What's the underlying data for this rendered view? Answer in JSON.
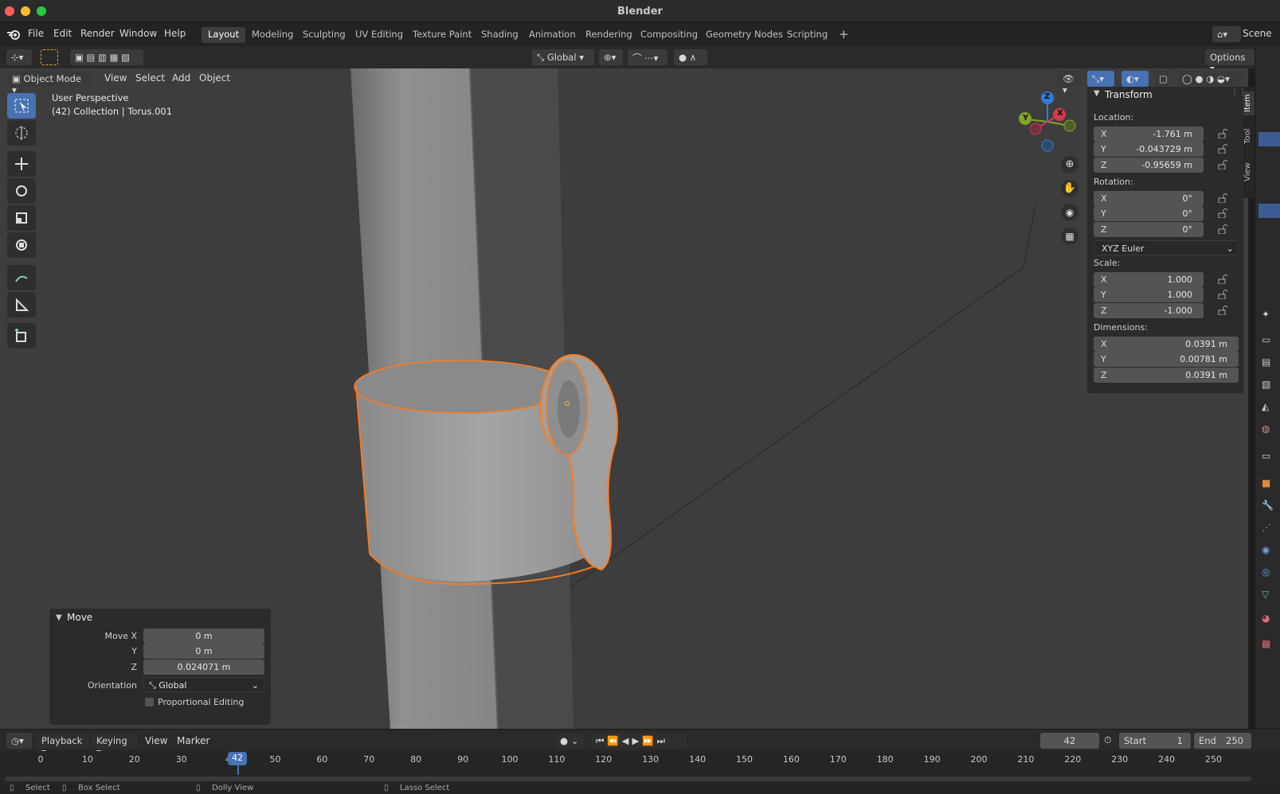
{
  "window": {
    "title": "Blender"
  },
  "menu": {
    "items": [
      "File",
      "Edit",
      "Render",
      "Window",
      "Help"
    ]
  },
  "workspaces": [
    "Layout",
    "Modeling",
    "Sculpting",
    "UV Editing",
    "Texture Paint",
    "Shading",
    "Animation",
    "Rendering",
    "Compositing",
    "Geometry Nodes",
    "Scripting"
  ],
  "active_workspace": "Layout",
  "scene_label": "Scene",
  "header": {
    "orientation": "Global",
    "options": "Options"
  },
  "viewport_header": {
    "mode": "Object Mode",
    "menus": [
      "View",
      "Select",
      "Add",
      "Object"
    ]
  },
  "overlay": {
    "perspective": "User Perspective",
    "collection": "(42) Collection | Torus.001"
  },
  "gizmo": {
    "x": "X",
    "y": "Y",
    "z": "Z"
  },
  "npanel": {
    "section": "Transform",
    "location_label": "Location:",
    "location": [
      {
        "axis": "X",
        "value": "-1.761 m"
      },
      {
        "axis": "Y",
        "value": "-0.043729 m"
      },
      {
        "axis": "Z",
        "value": "-0.95659 m"
      }
    ],
    "rotation_label": "Rotation:",
    "rotation": [
      {
        "axis": "X",
        "value": "0°"
      },
      {
        "axis": "Y",
        "value": "0°"
      },
      {
        "axis": "Z",
        "value": "0°"
      }
    ],
    "rotation_mode": "XYZ Euler",
    "scale_label": "Scale:",
    "scale": [
      {
        "axis": "X",
        "value": "1.000"
      },
      {
        "axis": "Y",
        "value": "1.000"
      },
      {
        "axis": "Z",
        "value": "-1.000"
      }
    ],
    "dimensions_label": "Dimensions:",
    "dimensions": [
      {
        "axis": "X",
        "value": "0.0391 m"
      },
      {
        "axis": "Y",
        "value": "0.00781 m"
      },
      {
        "axis": "Z",
        "value": "0.0391 m"
      }
    ],
    "tabs": [
      "Item",
      "Tool",
      "View"
    ]
  },
  "move_panel": {
    "title": "Move",
    "rows": [
      {
        "label": "Move X",
        "value": "0 m"
      },
      {
        "label": "Y",
        "value": "0 m"
      },
      {
        "label": "Z",
        "value": "0.024071 m"
      }
    ],
    "orientation_label": "Orientation",
    "orientation_value": "Global",
    "proportional": "Proportional Editing"
  },
  "timeline": {
    "menus": [
      "Playback",
      "Keying",
      "View",
      "Marker"
    ],
    "current_frame": "42",
    "start_label": "Start",
    "start": "1",
    "end_label": "End",
    "end": "250",
    "ticks": [
      "0",
      "10",
      "20",
      "30",
      "4",
      "50",
      "60",
      "70",
      "80",
      "90",
      "100",
      "110",
      "120",
      "130",
      "140",
      "150",
      "160",
      "170",
      "180",
      "190",
      "200",
      "210",
      "220",
      "230",
      "240",
      "250"
    ]
  },
  "status": {
    "items": [
      "Select",
      "Box Select",
      "Dolly View",
      "Lasso Select"
    ]
  },
  "colors": {
    "accent": "#4772b3",
    "selection": "#f07a24",
    "viewport_bg": "#3d3d3d"
  }
}
